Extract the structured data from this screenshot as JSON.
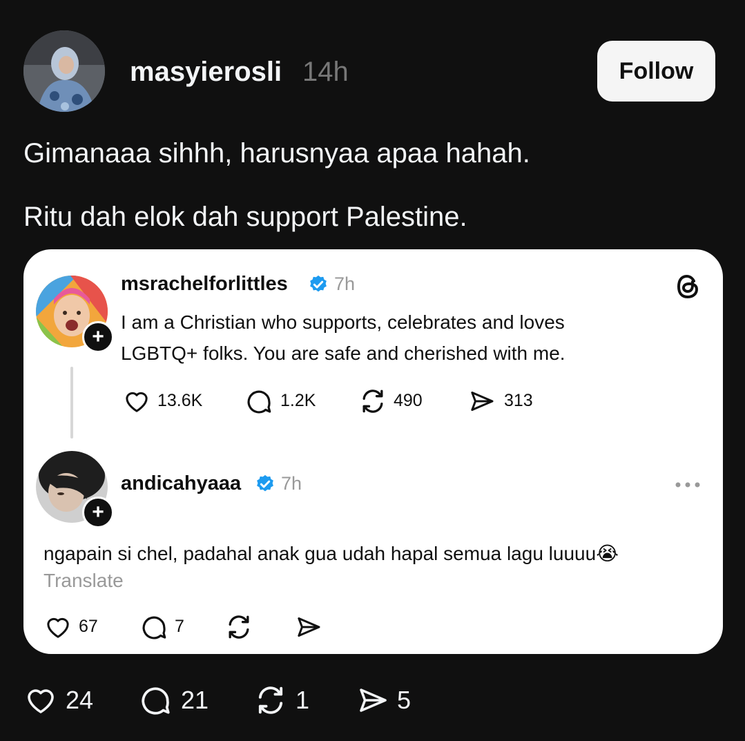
{
  "post": {
    "username": "masyierosli",
    "time": "14h",
    "follow_label": "Follow",
    "lines": [
      "Gimanaaa sihhh, harusnyaa apaa hahah.",
      "Ritu dah elok dah support Palestine."
    ],
    "stats": {
      "likes": "24",
      "replies": "21",
      "reposts": "1",
      "shares": "5"
    }
  },
  "quoted": {
    "post1": {
      "username": "msrachelforlittles",
      "time": "7h",
      "line1": "I am a Christian who supports, celebrates and loves",
      "line2": "LGBTQ+ folks. You are safe and cherished with me.",
      "stats": {
        "likes": "13.6K",
        "replies": "1.2K",
        "reposts": "490",
        "shares": "313"
      }
    },
    "post2": {
      "username": "andicahyaaa",
      "time": "7h",
      "text": "ngapain si chel, padahal anak gua udah hapal semua lagu luuuu",
      "emoji": "😭",
      "translate_label": "Translate",
      "stats": {
        "likes": "67",
        "replies": "7"
      }
    }
  },
  "colors": {
    "background": "#101010",
    "text": "#f3f5f7",
    "muted": "#777777",
    "verified": "#1d9bf0",
    "card": "#ffffff"
  },
  "icons": [
    "heart-icon",
    "comment-icon",
    "repost-icon",
    "share-icon",
    "verified-icon",
    "threads-logo-icon",
    "more-icon",
    "plus-icon"
  ]
}
